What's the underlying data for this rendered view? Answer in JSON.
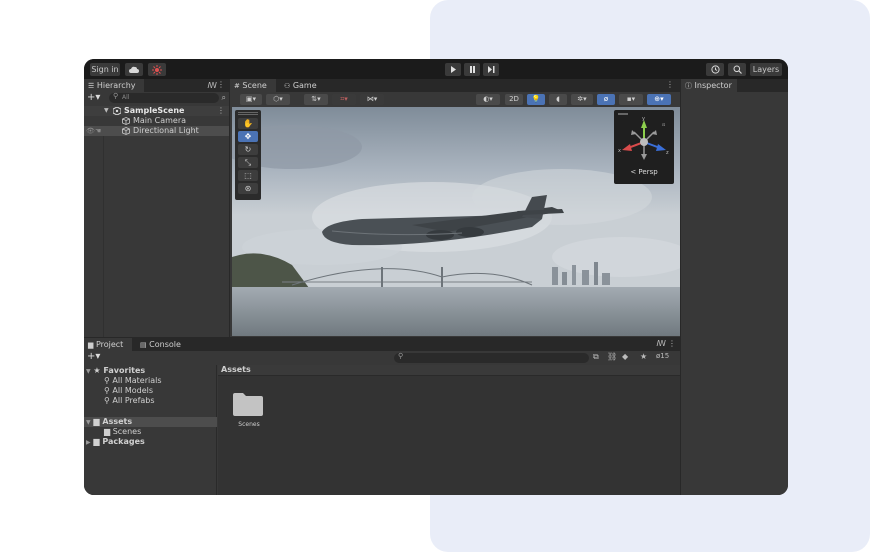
{
  "topbar": {
    "sign_in": "Sign in",
    "layers": "Layers"
  },
  "hierarchy": {
    "tab": "Hierarchy",
    "search_placeholder": "All",
    "scene_name": "SampleScene",
    "items": [
      "Main Camera",
      "Directional Light"
    ]
  },
  "scene_tabs": {
    "scene": "Scene",
    "game": "Game"
  },
  "scene_toolbar": {
    "mode_2d": "2D"
  },
  "gizmo": {
    "persp": "Persp",
    "axes": [
      "y",
      "x",
      "z"
    ]
  },
  "inspector": {
    "tab": "Inspector"
  },
  "project": {
    "tab_project": "Project",
    "tab_console": "Console",
    "favorites_label": "Favorites",
    "favorites": [
      "All Materials",
      "All Models",
      "All Prefabs"
    ],
    "assets_label": "Assets",
    "assets_children": [
      "Scenes"
    ],
    "packages_label": "Packages",
    "breadcrumb": "Assets",
    "hidden_count": "15",
    "folders": [
      "Scenes"
    ]
  },
  "colors": {
    "accent_blue": "#4b73b5",
    "panel": "#383838",
    "dark": "#282828"
  }
}
